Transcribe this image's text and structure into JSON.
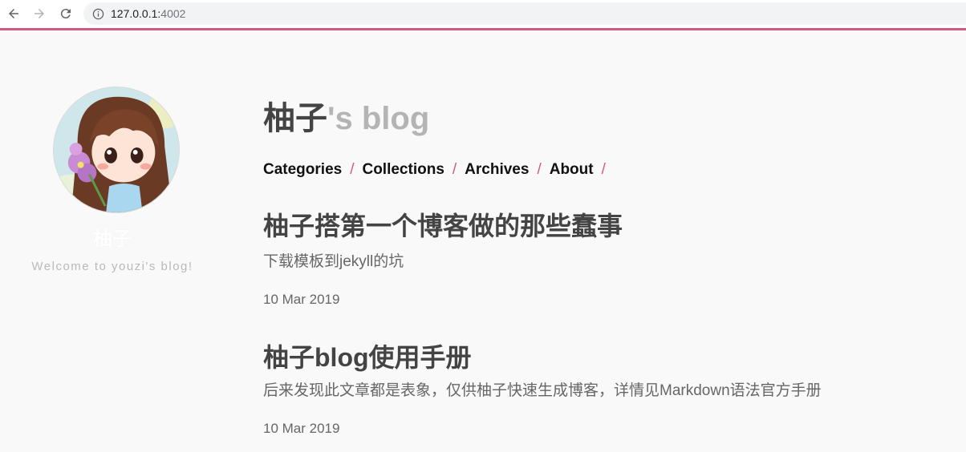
{
  "browser": {
    "url_host": "127.0.0.1:",
    "url_port": "4002",
    "accent_color": "#d05a82"
  },
  "sidebar": {
    "author_name": "柚子",
    "tagline": "Welcome to youzi's blog!"
  },
  "header": {
    "title_main": "柚子",
    "title_suffix": "'s blog"
  },
  "nav": {
    "items": [
      {
        "label": "Categories"
      },
      {
        "label": "Collections"
      },
      {
        "label": "Archives"
      },
      {
        "label": "About"
      }
    ],
    "separator": "/"
  },
  "posts": [
    {
      "title": "柚子搭第一个博客做的那些蠢事",
      "description": "下载模板到jekyll的坑",
      "date": "10 Mar 2019"
    },
    {
      "title": "柚子blog使用手册",
      "description": "后来发现此文章都是表象，仅供柚子快速生成博客，详情见Markdown语法官方手册",
      "date": "10 Mar 2019"
    }
  ]
}
